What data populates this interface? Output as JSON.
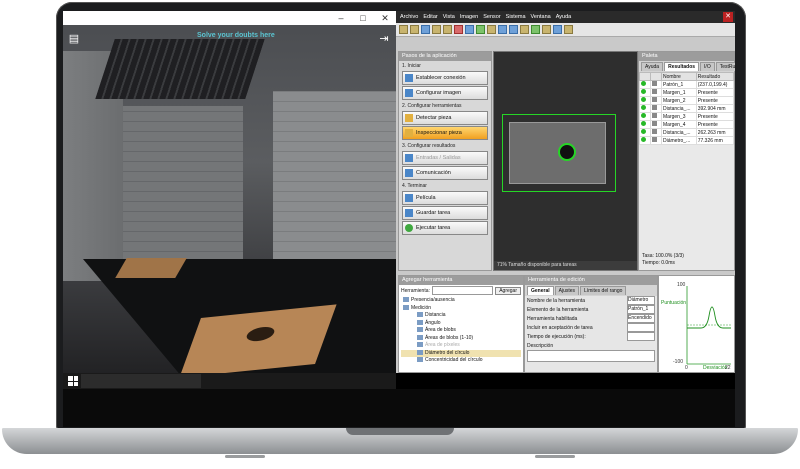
{
  "sim": {
    "banner": "Solve your doubts here"
  },
  "app": {
    "menu": [
      "Archivo",
      "Editar",
      "Vista",
      "Imagen",
      "Sensor",
      "Sistema",
      "Ventana",
      "Ayuda"
    ],
    "steps_title": "Pasos de la aplicación",
    "steps": [
      {
        "header": "1. Iniciar",
        "buttons": [
          {
            "label": "Establecer conexión",
            "state": "normal"
          },
          {
            "label": "Configurar imagen",
            "state": "normal"
          }
        ]
      },
      {
        "header": "2. Configurar herramientas",
        "buttons": [
          {
            "label": "Detectar pieza",
            "state": "normal"
          },
          {
            "label": "Inspeccionar pieza",
            "state": "active"
          }
        ]
      },
      {
        "header": "3. Configurar resultados",
        "buttons": [
          {
            "label": "Entradas / Salidas",
            "state": "disabled"
          },
          {
            "label": "Comunicación",
            "state": "normal"
          }
        ]
      },
      {
        "header": "4. Terminar",
        "buttons": [
          {
            "label": "Película",
            "state": "normal"
          },
          {
            "label": "Guardar tarea",
            "state": "normal"
          },
          {
            "label": "Ejecutar tarea",
            "state": "normal"
          }
        ]
      }
    ],
    "image_status": "71% Tamaño disponible para tareas",
    "palette": {
      "title": "Paleta",
      "tabs": [
        "Ayuda",
        "Resultados",
        "I/O",
        "TestRun™"
      ],
      "active_tab": "Resultados",
      "columns": [
        "Nombre",
        "Resultado"
      ],
      "rows": [
        {
          "name": "Patrón_1",
          "result": "(237.0,199.4)"
        },
        {
          "name": "Margen_1",
          "result": "Presente"
        },
        {
          "name": "Margen_2",
          "result": "Presente"
        },
        {
          "name": "Distancia_...",
          "result": "392.904 mm"
        },
        {
          "name": "Margen_3",
          "result": "Presente"
        },
        {
          "name": "Margen_4",
          "result": "Presente"
        },
        {
          "name": "Distancia_...",
          "result": "262.263 mm"
        },
        {
          "name": "Diámetro_...",
          "result": "77.326 mm"
        }
      ],
      "rate": "Tasa: 100.0% (3/3)",
      "time": "Tiempo: 0.0ms"
    },
    "add_tool": {
      "title": "Agregar herramienta",
      "field_label": "Herramienta:",
      "add_button": "Agregar",
      "tree": [
        {
          "label": "Presencia/ausencia",
          "level": 0,
          "state": "normal"
        },
        {
          "label": "Medición",
          "level": 0,
          "state": "normal"
        },
        {
          "label": "Distancia",
          "level": 1,
          "state": "normal"
        },
        {
          "label": "Ángulo",
          "level": 1,
          "state": "normal"
        },
        {
          "label": "Área de blobs",
          "level": 1,
          "state": "normal"
        },
        {
          "label": "Áreas de blobs (1-10)",
          "level": 1,
          "state": "normal"
        },
        {
          "label": "Área de píxeles",
          "level": 1,
          "state": "disabled"
        },
        {
          "label": "Diámetro del círculo",
          "level": 1,
          "state": "selected"
        },
        {
          "label": "Concentricidad del círculo",
          "level": 1,
          "state": "normal"
        }
      ]
    },
    "edit": {
      "title": "Herramienta de edición",
      "tabs": [
        "General",
        "Ajustes",
        "Límites del rango"
      ],
      "fields": [
        {
          "label": "Nombre de la herramienta",
          "value": "Diámetro"
        },
        {
          "label": "Elemento de la herramienta",
          "value": "Patrón_1"
        },
        {
          "label": "Herramienta habilitada",
          "value": "Encendido"
        },
        {
          "label": "Incluir en aceptación de tarea",
          "value": ""
        },
        {
          "label": "Tiempo de ejecución (ms):",
          "value": ""
        }
      ],
      "description_label": "Descripción"
    },
    "graph": {
      "ymax": "100",
      "ymin": "-100",
      "ylabel": "Puntuación",
      "xmin": "0",
      "xmax": "22",
      "xlabel": "Desviación"
    }
  }
}
